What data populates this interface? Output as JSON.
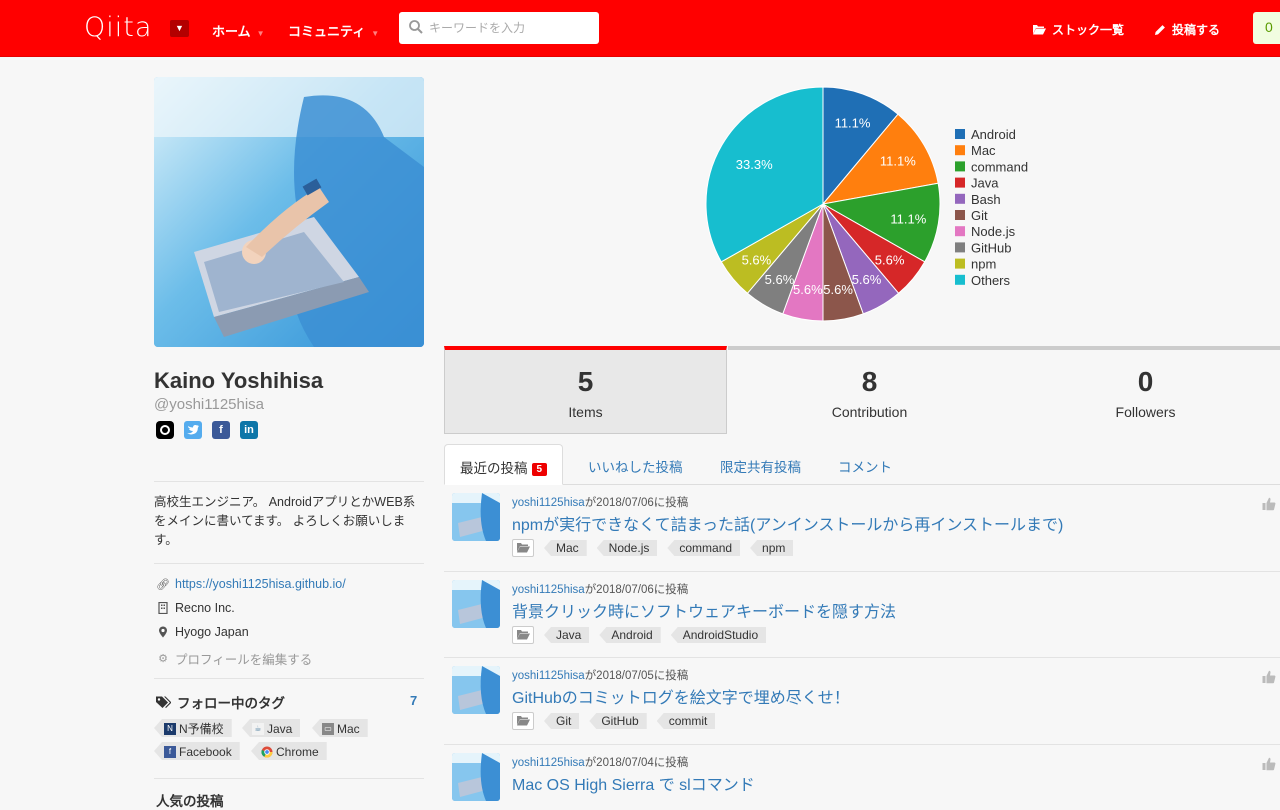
{
  "header": {
    "logo": "Qiita",
    "nav": [
      {
        "label": "ホーム"
      },
      {
        "label": "コミュニティ"
      }
    ],
    "search": {
      "placeholder": "キーワードを入力",
      "value": ""
    },
    "stock_label": "ストック一覧",
    "post_label": "投稿する",
    "notification_count": "0"
  },
  "profile": {
    "name": "Kaino Yoshihisa",
    "handle": "@yoshi1125hisa",
    "socials": [
      "github-icon",
      "twitter-icon",
      "facebook-icon",
      "linkedin-icon"
    ],
    "bio": "高校生エンジニア。 AndroidアプリとかWEB系をメインに書いてます。 よろしくお願いします。",
    "website": "https://yoshi1125hisa.github.io/",
    "company": "Recno Inc.",
    "location": "Hyogo Japan",
    "edit_label": "プロフィールを編集する",
    "following_tags_label": "フォロー中のタグ",
    "following_tags_count": "7",
    "following_tags": [
      {
        "label": "N予備校",
        "icon": "n-yobiko-icon",
        "color": "#1b3a6b"
      },
      {
        "label": "Java",
        "icon": "java-icon",
        "color": "#5382a1"
      },
      {
        "label": "Mac",
        "icon": "mac-icon",
        "color": "#888888"
      },
      {
        "label": "Facebook",
        "icon": "facebook-icon",
        "color": "#3b5998"
      },
      {
        "label": "Chrome",
        "icon": "chrome-icon",
        "color": "#dd4b39"
      }
    ],
    "popular_label": "人気の投稿"
  },
  "chart_data": {
    "type": "pie",
    "title": "",
    "legend_position": "right",
    "slices": [
      {
        "label": "Android",
        "value": 11.1,
        "text": "11.1%",
        "color": "#1f6fb5"
      },
      {
        "label": "Mac",
        "value": 11.1,
        "text": "11.1%",
        "color": "#ff7f0e"
      },
      {
        "label": "command",
        "value": 11.1,
        "text": "11.1%",
        "color": "#2ca02c"
      },
      {
        "label": "Java",
        "value": 5.6,
        "text": "5.6%",
        "color": "#d62728"
      },
      {
        "label": "Bash",
        "value": 5.6,
        "text": "5.6%",
        "color": "#9467bd"
      },
      {
        "label": "Git",
        "value": 5.6,
        "text": "5.6%",
        "color": "#8c564b"
      },
      {
        "label": "Node.js",
        "value": 5.6,
        "text": "5.6%",
        "color": "#e377c2"
      },
      {
        "label": "GitHub",
        "value": 5.6,
        "text": "5.6%",
        "color": "#7f7f7f"
      },
      {
        "label": "npm",
        "value": 5.6,
        "text": "5.6%",
        "color": "#bcbd22"
      },
      {
        "label": "Others",
        "value": 33.3,
        "text": "33.3%",
        "color": "#17becf"
      }
    ]
  },
  "stats": [
    {
      "num": "5",
      "label": "Items"
    },
    {
      "num": "8",
      "label": "Contribution"
    },
    {
      "num": "0",
      "label": "Followers"
    }
  ],
  "tabs": [
    {
      "label": "最近の投稿",
      "badge": "5"
    },
    {
      "label": "いいねした投稿"
    },
    {
      "label": "限定共有投稿"
    },
    {
      "label": "コメント"
    }
  ],
  "posts": [
    {
      "user": "yoshi1125hisa",
      "date": "が2018/07/06に投稿",
      "title": "npmが実行できなくて詰まった話(アンインストールから再インストールまで)",
      "tags": [
        "Mac",
        "Node.js",
        "command",
        "npm"
      ]
    },
    {
      "user": "yoshi1125hisa",
      "date": "が2018/07/06に投稿",
      "title": "背景クリック時にソフトウェアキーボードを隠す方法",
      "tags": [
        "Java",
        "Android",
        "AndroidStudio"
      ]
    },
    {
      "user": "yoshi1125hisa",
      "date": "が2018/07/05に投稿",
      "title": "GitHubのコミットログを絵文字で埋め尽くせ！",
      "tags": [
        "Git",
        "GitHub",
        "commit"
      ]
    },
    {
      "user": "yoshi1125hisa",
      "date": "が2018/07/04に投稿",
      "title": "Mac OS High Sierra で slコマンド",
      "tags": []
    }
  ],
  "colors": {
    "brand": "#ff0000",
    "link": "#337ab7"
  }
}
